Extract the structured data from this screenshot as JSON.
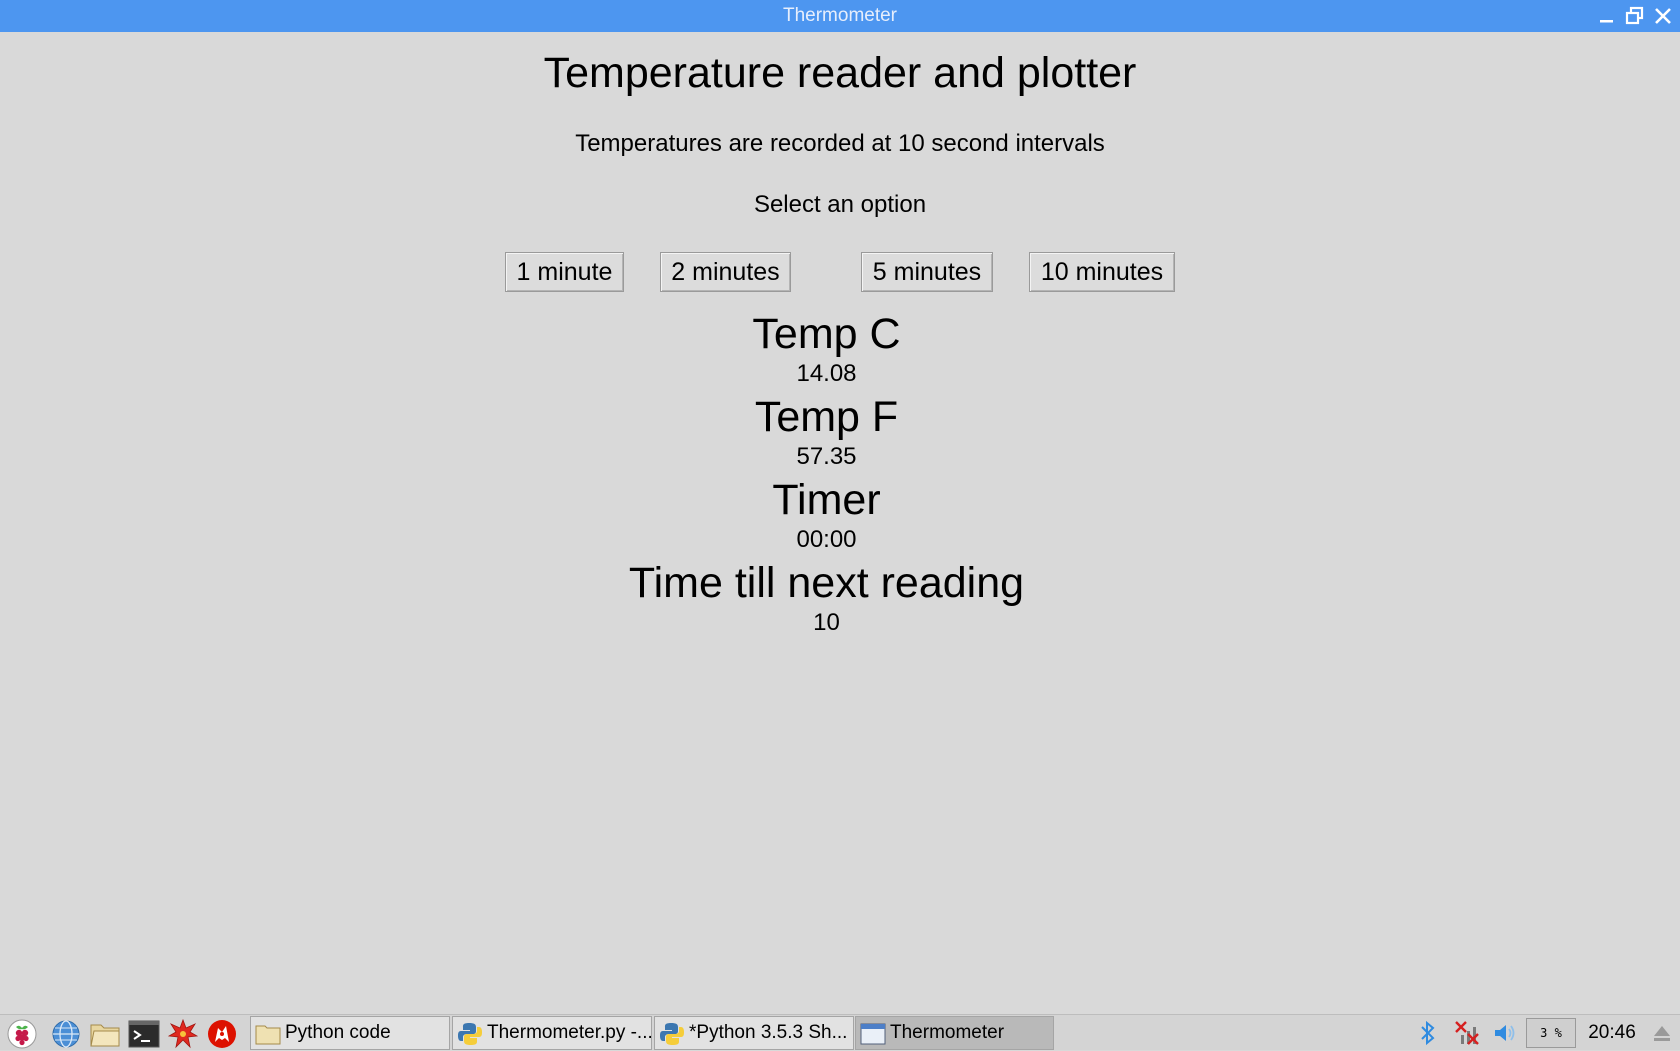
{
  "window": {
    "title": "Thermometer",
    "minimize_icon": "minimize-icon",
    "maximize_icon": "maximize-icon",
    "close_icon": "close-icon"
  },
  "main": {
    "heading": "Temperature reader and plotter",
    "subtitle": "Temperatures are recorded at 10 second intervals",
    "prompt": "Select an option",
    "options": [
      {
        "label": "1 minute"
      },
      {
        "label": "2 minutes"
      },
      {
        "label": "5 minutes"
      },
      {
        "label": "10 minutes"
      }
    ],
    "readings": [
      {
        "label": "Temp C",
        "value": "14.08"
      },
      {
        "label": "Temp F",
        "value": "57.35"
      },
      {
        "label": "Timer",
        "value": "00:00"
      },
      {
        "label": "Time till next reading",
        "value": "10"
      }
    ]
  },
  "taskbar": {
    "launchers": [
      {
        "icon": "raspberry-menu-icon"
      },
      {
        "icon": "web-browser-icon"
      },
      {
        "icon": "file-manager-icon"
      },
      {
        "icon": "terminal-icon"
      },
      {
        "icon": "mathematica-icon"
      },
      {
        "icon": "wolfram-icon"
      }
    ],
    "tasks": [
      {
        "label": "Python code",
        "icon": "folder-icon"
      },
      {
        "label": "Thermometer.py -...",
        "icon": "python-icon"
      },
      {
        "label": "*Python 3.5.3 Sh...",
        "icon": "python-icon"
      },
      {
        "label": "Thermometer",
        "icon": "window-icon"
      }
    ],
    "tray": {
      "bluetooth_icon": "bluetooth-icon",
      "network_icon": "network-disconnected-icon",
      "volume_icon": "volume-icon",
      "cpu": "3 %",
      "clock": "20:46",
      "eject_icon": "eject-icon"
    },
    "colors": {
      "titlebar": "#4d96f0",
      "tray_blue": "#2f8be0"
    }
  }
}
